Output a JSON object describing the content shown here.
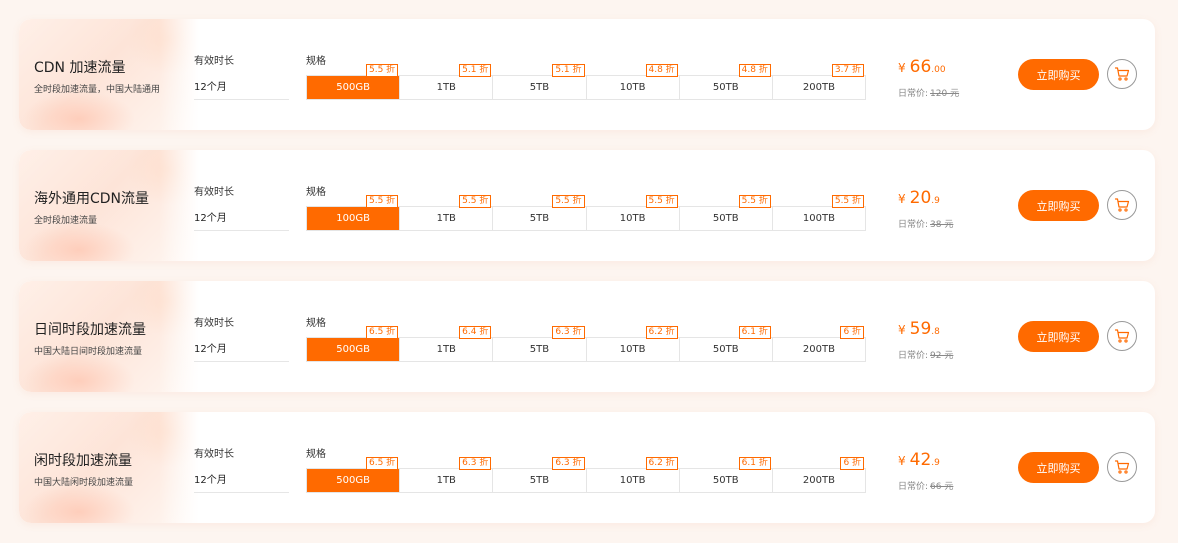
{
  "colors": {
    "accent": "#ff6a00"
  },
  "duration_label": "有效时长",
  "spec_label": "规格",
  "buy_label": "立即购买",
  "yen": "¥",
  "daily_label": "日常价:",
  "icons": {
    "cart": "cart-icon"
  },
  "products": [
    {
      "title": "CDN 加速流量",
      "subtitle": "全时段加速流量，中国大陆通用",
      "duration": "12个月",
      "specs": [
        {
          "size": "500GB",
          "discount": "5.5 折",
          "selected": true
        },
        {
          "size": "1TB",
          "discount": "5.1 折",
          "selected": false
        },
        {
          "size": "5TB",
          "discount": "5.1 折",
          "selected": false
        },
        {
          "size": "10TB",
          "discount": "4.8 折",
          "selected": false
        },
        {
          "size": "50TB",
          "discount": "4.8 折",
          "selected": false
        },
        {
          "size": "200TB",
          "discount": "3.7 折",
          "selected": false
        }
      ],
      "price_int": "66",
      "price_dec": ".00",
      "daily_price": "120 元"
    },
    {
      "title": "海外通用CDN流量",
      "subtitle": "全时段加速流量",
      "duration": "12个月",
      "specs": [
        {
          "size": "100GB",
          "discount": "5.5 折",
          "selected": true
        },
        {
          "size": "1TB",
          "discount": "5.5 折",
          "selected": false
        },
        {
          "size": "5TB",
          "discount": "5.5 折",
          "selected": false
        },
        {
          "size": "10TB",
          "discount": "5.5 折",
          "selected": false
        },
        {
          "size": "50TB",
          "discount": "5.5 折",
          "selected": false
        },
        {
          "size": "100TB",
          "discount": "5.5 折",
          "selected": false
        }
      ],
      "price_int": "20",
      "price_dec": ".9",
      "daily_price": "38 元"
    },
    {
      "title": "日间时段加速流量",
      "subtitle": "中国大陆日间时段加速流量",
      "duration": "12个月",
      "specs": [
        {
          "size": "500GB",
          "discount": "6.5 折",
          "selected": true
        },
        {
          "size": "1TB",
          "discount": "6.4 折",
          "selected": false
        },
        {
          "size": "5TB",
          "discount": "6.3 折",
          "selected": false
        },
        {
          "size": "10TB",
          "discount": "6.2 折",
          "selected": false
        },
        {
          "size": "50TB",
          "discount": "6.1 折",
          "selected": false
        },
        {
          "size": "200TB",
          "discount": "6 折",
          "selected": false
        }
      ],
      "price_int": "59",
      "price_dec": ".8",
      "daily_price": "92 元"
    },
    {
      "title": "闲时段加速流量",
      "subtitle": "中国大陆闲时段加速流量",
      "duration": "12个月",
      "specs": [
        {
          "size": "500GB",
          "discount": "6.5 折",
          "selected": true
        },
        {
          "size": "1TB",
          "discount": "6.3 折",
          "selected": false
        },
        {
          "size": "5TB",
          "discount": "6.3 折",
          "selected": false
        },
        {
          "size": "10TB",
          "discount": "6.2 折",
          "selected": false
        },
        {
          "size": "50TB",
          "discount": "6.1 折",
          "selected": false
        },
        {
          "size": "200TB",
          "discount": "6 折",
          "selected": false
        }
      ],
      "price_int": "42",
      "price_dec": ".9",
      "daily_price": "66 元"
    }
  ]
}
